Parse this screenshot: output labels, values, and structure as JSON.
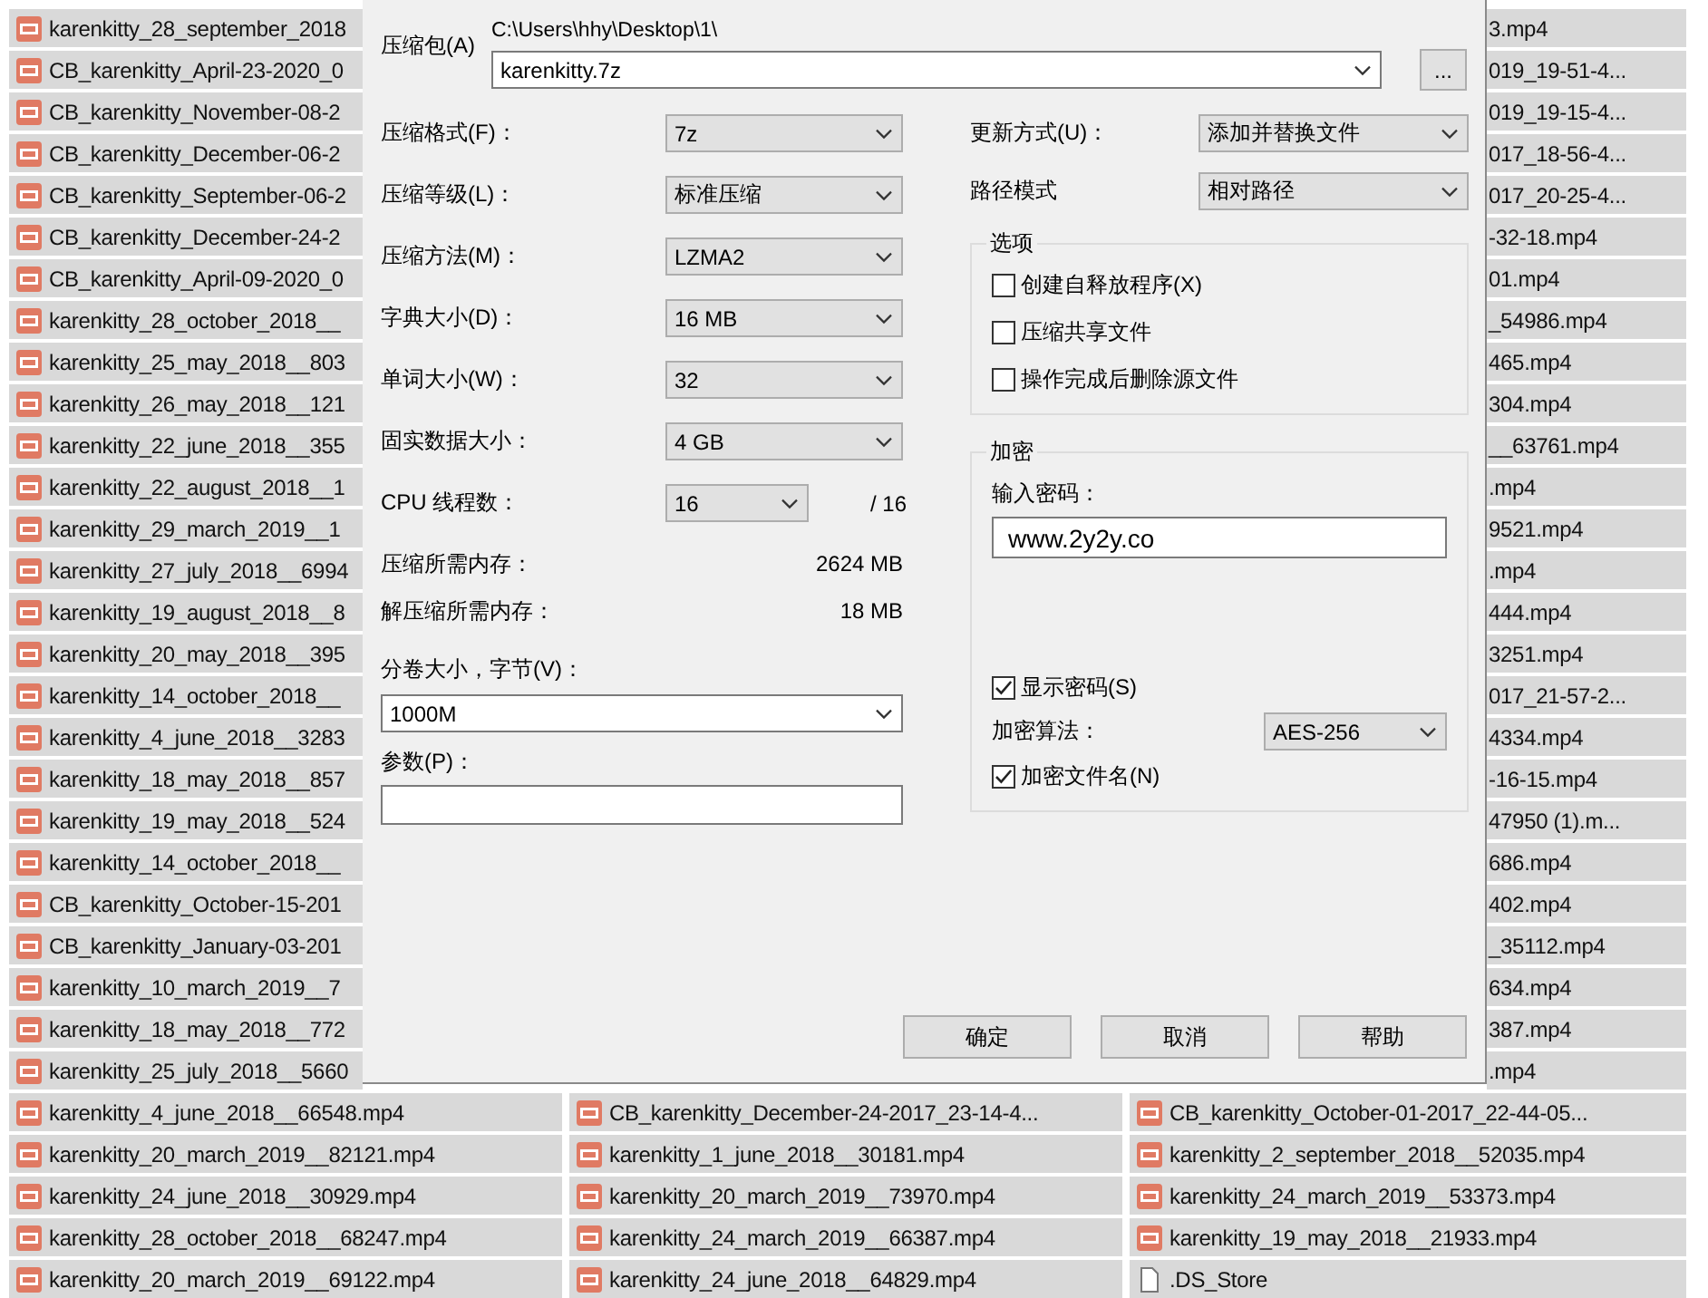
{
  "files_left_strip": [
    {
      "name": "karenkitty_28_september_2018",
      "kind": "video"
    },
    {
      "name": "CB_karenkitty_April-23-2020_0",
      "kind": "video"
    },
    {
      "name": "CB_karenkitty_November-08-2",
      "kind": "video"
    },
    {
      "name": "CB_karenkitty_December-06-2",
      "kind": "video"
    },
    {
      "name": "CB_karenkitty_September-06-2",
      "kind": "video"
    },
    {
      "name": "CB_karenkitty_December-24-2",
      "kind": "video"
    },
    {
      "name": "CB_karenkitty_April-09-2020_0",
      "kind": "video"
    },
    {
      "name": "karenkitty_28_october_2018__",
      "kind": "video"
    },
    {
      "name": "karenkitty_25_may_2018__803",
      "kind": "video"
    },
    {
      "name": "karenkitty_26_may_2018__121",
      "kind": "video"
    },
    {
      "name": "karenkitty_22_june_2018__355",
      "kind": "video"
    },
    {
      "name": "karenkitty_22_august_2018__1",
      "kind": "video"
    },
    {
      "name": "karenkitty_29_march_2019__1",
      "kind": "video"
    },
    {
      "name": "karenkitty_27_july_2018__6994",
      "kind": "video"
    },
    {
      "name": "karenkitty_19_august_2018__8",
      "kind": "video"
    },
    {
      "name": "karenkitty_20_may_2018__395",
      "kind": "video"
    },
    {
      "name": "karenkitty_14_october_2018__",
      "kind": "video"
    },
    {
      "name": "karenkitty_4_june_2018__3283",
      "kind": "video"
    },
    {
      "name": "karenkitty_18_may_2018__857",
      "kind": "video"
    },
    {
      "name": "karenkitty_19_may_2018__524",
      "kind": "video"
    },
    {
      "name": "karenkitty_14_october_2018__",
      "kind": "video"
    },
    {
      "name": "CB_karenkitty_October-15-201",
      "kind": "video"
    },
    {
      "name": "CB_karenkitty_January-03-201",
      "kind": "video"
    },
    {
      "name": "karenkitty_10_march_2019__7",
      "kind": "video"
    },
    {
      "name": "karenkitty_18_may_2018__772",
      "kind": "video"
    },
    {
      "name": "karenkitty_25_july_2018__5660",
      "kind": "video"
    }
  ],
  "files_right_strip": [
    "3.mp4",
    "019_19-51-4...",
    "019_19-15-4...",
    "017_18-56-4...",
    "017_20-25-4...",
    "-32-18.mp4",
    "01.mp4",
    "_54986.mp4",
    "465.mp4",
    "304.mp4",
    "__63761.mp4",
    ".mp4",
    "9521.mp4",
    ".mp4",
    "444.mp4",
    "3251.mp4",
    "017_21-57-2...",
    "4334.mp4",
    "-16-15.mp4",
    "47950 (1).m...",
    "686.mp4",
    "402.mp4",
    "_35112.mp4",
    "634.mp4",
    "387.mp4",
    ".mp4"
  ],
  "files_bottom_columns": [
    [
      {
        "name": "karenkitty_4_june_2018__66548.mp4",
        "kind": "video"
      },
      {
        "name": "karenkitty_20_march_2019__82121.mp4",
        "kind": "video"
      },
      {
        "name": "karenkitty_24_june_2018__30929.mp4",
        "kind": "video"
      },
      {
        "name": "karenkitty_28_october_2018__68247.mp4",
        "kind": "video"
      },
      {
        "name": "karenkitty_20_march_2019__69122.mp4",
        "kind": "video"
      }
    ],
    [
      {
        "name": "CB_karenkitty_December-24-2017_23-14-4...",
        "kind": "video"
      },
      {
        "name": "karenkitty_1_june_2018__30181.mp4",
        "kind": "video"
      },
      {
        "name": "karenkitty_20_march_2019__73970.mp4",
        "kind": "video"
      },
      {
        "name": "karenkitty_24_march_2019__66387.mp4",
        "kind": "video"
      },
      {
        "name": "karenkitty_24_june_2018__64829.mp4",
        "kind": "video"
      }
    ],
    [
      {
        "name": "CB_karenkitty_October-01-2017_22-44-05...",
        "kind": "video"
      },
      {
        "name": "karenkitty_2_september_2018__52035.mp4",
        "kind": "video"
      },
      {
        "name": "karenkitty_24_march_2019__53373.mp4",
        "kind": "video"
      },
      {
        "name": "karenkitty_19_may_2018__21933.mp4",
        "kind": "video"
      },
      {
        "name": ".DS_Store",
        "kind": "file"
      }
    ]
  ],
  "dialog": {
    "archive": {
      "label": "压缩包(A)",
      "path": "C:\\Users\\hhy\\Desktop\\1\\",
      "value": "karenkitty.7z",
      "browse": "..."
    },
    "left_fields": [
      {
        "kind": "select",
        "label": "压缩格式(F)：",
        "value": "7z"
      },
      {
        "kind": "select",
        "label": "压缩等级(L)：",
        "value": "标准压缩"
      },
      {
        "kind": "select",
        "label": "压缩方法(M)：",
        "value": "LZMA2"
      },
      {
        "kind": "select",
        "label": "字典大小(D)：",
        "value": "16 MB"
      },
      {
        "kind": "select",
        "label": "单词大小(W)：",
        "value": "32"
      },
      {
        "kind": "select",
        "label": "固实数据大小：",
        "value": "4 GB"
      },
      {
        "kind": "select_short",
        "label": "CPU 线程数：",
        "value": "16",
        "suffix": "/ 16"
      },
      {
        "kind": "info",
        "label": "压缩所需内存：",
        "value": "2624 MB"
      },
      {
        "kind": "info",
        "label": "解压缩所需内存：",
        "value": "18 MB"
      }
    ],
    "volume": {
      "label": "分卷大小，字节(V)：",
      "value": "1000M"
    },
    "parameters": {
      "label": "参数(P)："
    },
    "right_fields": [
      {
        "label": "更新方式(U)：",
        "value": "添加并替换文件"
      },
      {
        "label": "路径模式",
        "value": "相对路径"
      }
    ],
    "options": {
      "title": "选项",
      "items": [
        {
          "label": "创建自释放程序(X)",
          "checked": false
        },
        {
          "label": "压缩共享文件",
          "checked": false
        },
        {
          "label": "操作完成后删除源文件",
          "checked": false
        }
      ]
    },
    "encryption": {
      "title": "加密",
      "password_label": "输入密码：",
      "password": "www.2y2y.co",
      "show_password": {
        "label": "显示密码(S)",
        "checked": true
      },
      "method_label": "加密算法：",
      "method": "AES-256",
      "encrypt_names": {
        "label": "加密文件名(N)",
        "checked": true
      }
    },
    "buttons": [
      "确定",
      "取消",
      "帮助"
    ]
  }
}
